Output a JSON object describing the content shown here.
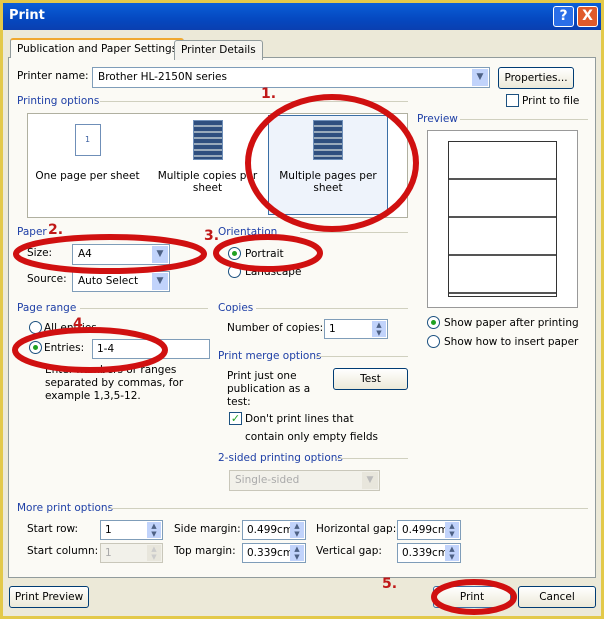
{
  "window": {
    "title": "Print",
    "help": "?",
    "close": "X"
  },
  "tabs": [
    {
      "label": "Publication and Paper Settings",
      "active": true
    },
    {
      "label": "Printer Details"
    }
  ],
  "printer": {
    "label": "Printer name:",
    "value": "Brother HL-2150N series",
    "properties": "Properties...",
    "print_to_file": "Print to file",
    "print_to_file_checked": false
  },
  "printing_options": {
    "legend": "Printing options",
    "items": [
      {
        "label": "One page per sheet"
      },
      {
        "label": "Multiple copies per sheet"
      },
      {
        "label": "Multiple pages per sheet",
        "selected": true
      }
    ]
  },
  "preview": {
    "legend": "Preview",
    "show_after": "Show paper after printing",
    "show_insert": "Show how to insert paper",
    "selected": "show_after"
  },
  "paper": {
    "legend": "Paper",
    "size_label": "Size:",
    "size": "A4",
    "source_label": "Source:",
    "source": "Auto Select"
  },
  "orientation": {
    "legend": "Orientation",
    "portrait": "Portrait",
    "landscape": "Landscape",
    "selected": "portrait"
  },
  "page_range": {
    "legend": "Page range",
    "all": "All entries",
    "entries": "Entries:",
    "entries_value": "1-4",
    "selected": "entries",
    "help": "Enter numbers or ranges separated by commas, for example 1,3,5-12."
  },
  "copies": {
    "legend": "Copies",
    "label": "Number of copies:",
    "value": "1"
  },
  "merge": {
    "legend": "Print merge options",
    "text": "Print just one publication as a test:",
    "test": "Test",
    "dont_print": "Don't print lines that",
    "dont_print2": "contain only empty fields",
    "checked": true
  },
  "two_sided": {
    "legend": "2-sided printing options",
    "value": "Single-sided"
  },
  "more": {
    "legend": "More print options",
    "start_row": "Start row:",
    "start_row_value": "1",
    "start_col": "Start column:",
    "start_col_value": "1",
    "side_margin": "Side margin:",
    "side_margin_value": "0.499cm",
    "top_margin": "Top margin:",
    "top_margin_value": "0.339cm",
    "h_gap": "Horizontal gap:",
    "h_gap_value": "0.499cm",
    "v_gap": "Vertical gap:",
    "v_gap_value": "0.339cm"
  },
  "buttons": {
    "print_preview": "Print Preview",
    "print": "Print",
    "cancel": "Cancel"
  },
  "annotations": {
    "a1": "1.",
    "a2": "2.",
    "a3": "3.",
    "a4": "4",
    "a5": "5.",
    "color": "#d01010"
  }
}
